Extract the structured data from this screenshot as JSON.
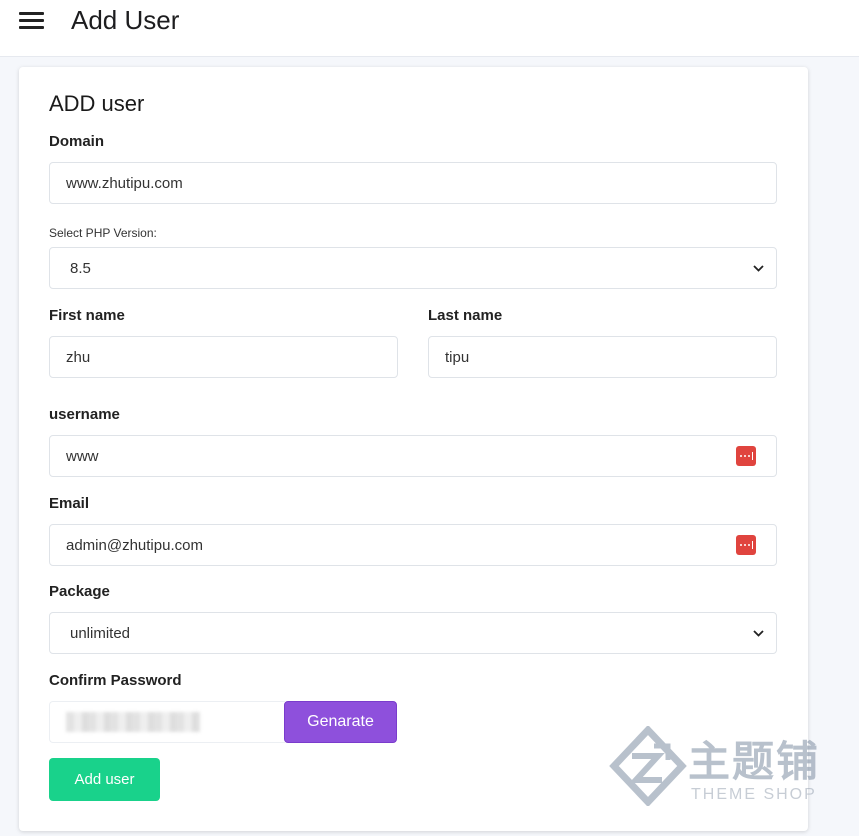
{
  "header": {
    "title": "Add User",
    "menu_icon": "hamburger-menu-icon"
  },
  "form": {
    "title": "ADD user",
    "domain": {
      "label": "Domain",
      "value": "www.zhutipu.com"
    },
    "php_version": {
      "label": "Select PHP Version:",
      "selected": "8.5"
    },
    "first_name": {
      "label": "First name",
      "value": "zhu"
    },
    "last_name": {
      "label": "Last name",
      "value": "tipu"
    },
    "username": {
      "label": "username",
      "value": "www"
    },
    "email": {
      "label": "Email",
      "value": "admin@zhutipu.com"
    },
    "package": {
      "label": "Package",
      "selected": "unlimited"
    },
    "confirm_password": {
      "label": "Confirm Password"
    },
    "generate_label": "Genarate",
    "submit_label": "Add user"
  },
  "watermark": {
    "main": "主题铺",
    "sub": "THEME SHOP"
  },
  "colors": {
    "generate_button": "#8e50dc",
    "submit_button": "#19d28b",
    "password_manager_icon": "#e0443e"
  }
}
